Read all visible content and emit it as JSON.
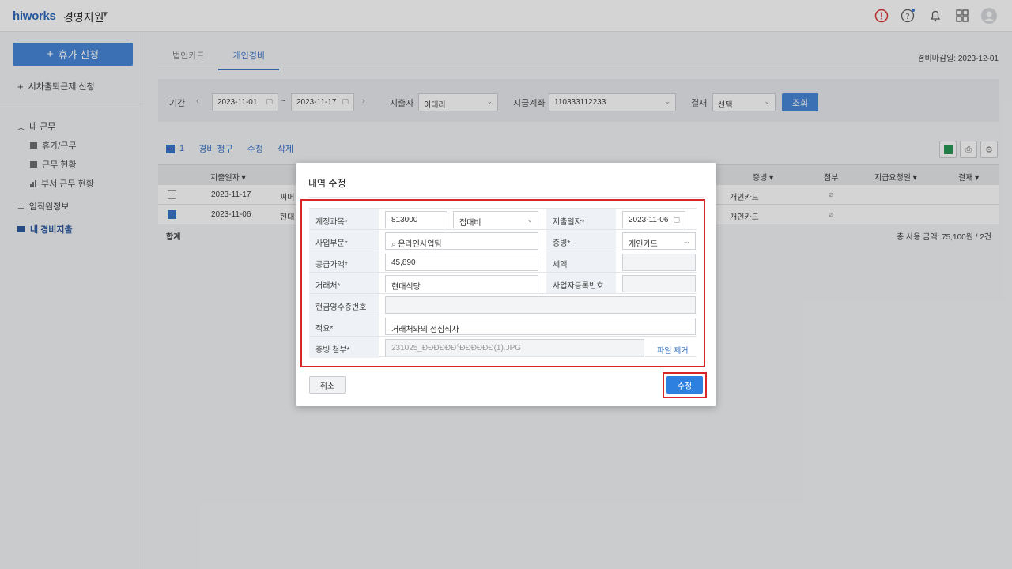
{
  "header": {
    "logo": "hiworks",
    "app_name": "경영지원"
  },
  "sidebar": {
    "vacation_button": "휴가 신청",
    "flex_apply": "시차출퇴근제 신청",
    "my_work": "내 근무",
    "sub_items": [
      "휴가/근무",
      "근무 현황",
      "부서 근무 현황"
    ],
    "staff_info": "임직원정보",
    "my_expense": "내 경비지출"
  },
  "tabs": [
    "법인카드",
    "개인경비"
  ],
  "deadline": "경비마감일: 2023-12-01",
  "filter": {
    "period_label": "기간",
    "date_from": "2023-11-01",
    "tilde": "~",
    "date_to": "2023-11-17",
    "payer_label": "지출자",
    "payer_value": "이대리",
    "account_label": "지급계좌",
    "account_value": "110333112233",
    "approval_label": "결재",
    "approval_value": "선택",
    "search_button": "조회"
  },
  "actions": {
    "count": "1",
    "claim": "경비 청구",
    "edit": "수정",
    "delete": "삭제"
  },
  "table": {
    "headers": [
      "지출일자 ▾",
      "증빙 ▾",
      "첨부",
      "지급요청일 ▾",
      "결재 ▾"
    ],
    "rows": [
      {
        "date": "2023-11-17",
        "vendor": "씨머",
        "evidence": "개인카드"
      },
      {
        "date": "2023-11-06",
        "vendor": "현대",
        "evidence": "개인카드"
      }
    ],
    "total_label": "합계",
    "total_value": "총 사용 금액: 75,100원 / 2건"
  },
  "modal": {
    "title": "내역 수정",
    "account_label": "계정과목*",
    "account_code": "813000",
    "account_name": "접대비",
    "date_label": "지출일자*",
    "date_value": "2023-11-06",
    "dept_label": "사업부문*",
    "dept_value": "온라인사업팀",
    "evidence_label": "증빙*",
    "evidence_value": "개인카드",
    "supply_label": "공급가액*",
    "supply_value": "45,890",
    "tax_label": "세액",
    "vendor_label": "거래처*",
    "vendor_value": "현대식당",
    "bizno_label": "사업자등록번호",
    "receipt_label": "현금영수증번호",
    "memo_label": "적요*",
    "memo_value": "거래처와의 점심식사",
    "attach_label": "증빙 첨부*",
    "attach_value": "231025_ÐÐÐÐÐÐ°ÐÐÐÐÐÐ(1).JPG",
    "file_remove": "파일 제거",
    "cancel": "취소",
    "save": "수정"
  }
}
